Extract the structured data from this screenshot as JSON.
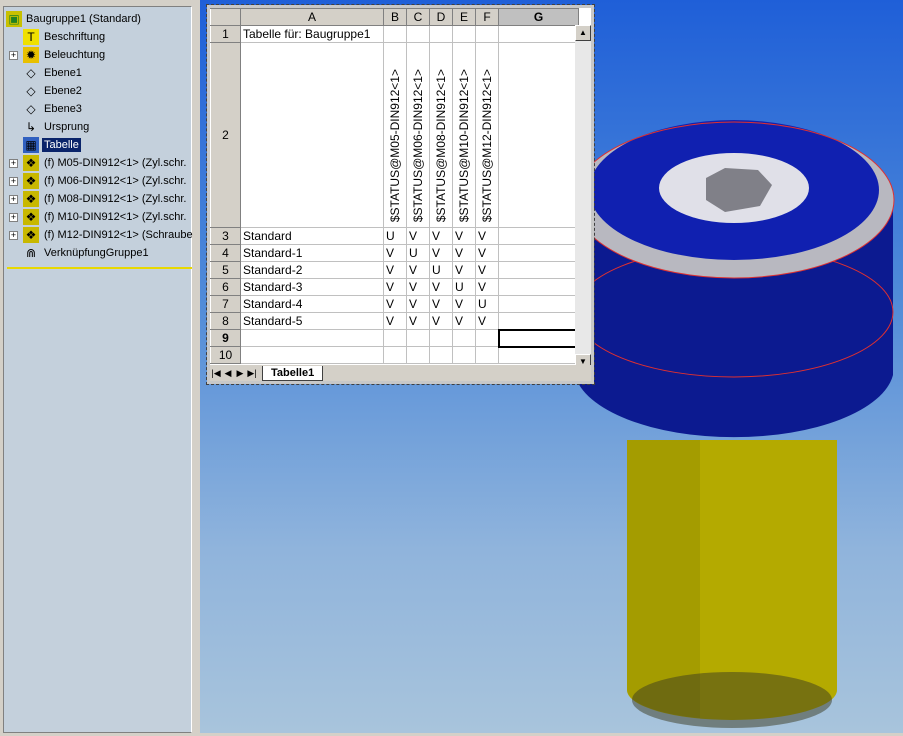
{
  "tree": {
    "root": "Baugruppe1  (Standard)",
    "items": [
      {
        "label": "Beschriftung",
        "icon": "annotation-icon",
        "expand": false
      },
      {
        "label": "Beleuchtung",
        "icon": "lighting-folder-icon",
        "expand": true
      },
      {
        "label": "Ebene1",
        "icon": "plane-icon",
        "expand": false
      },
      {
        "label": "Ebene2",
        "icon": "plane-icon",
        "expand": false
      },
      {
        "label": "Ebene3",
        "icon": "plane-icon",
        "expand": false
      },
      {
        "label": "Ursprung",
        "icon": "origin-icon",
        "expand": false
      },
      {
        "label": "Tabelle",
        "icon": "design-table-icon",
        "expand": false,
        "selected": true
      },
      {
        "label": "(f) M05-DIN912<1> (Zyl.schr.",
        "icon": "part-icon",
        "expand": true
      },
      {
        "label": "(f) M06-DIN912<1> (Zyl.schr.",
        "icon": "part-icon",
        "expand": true
      },
      {
        "label": "(f) M08-DIN912<1> (Zyl.schr.",
        "icon": "part-icon",
        "expand": true
      },
      {
        "label": "(f) M10-DIN912<1> (Zyl.schr.",
        "icon": "part-icon",
        "expand": true
      },
      {
        "label": "(f) M12-DIN912<1> (Schraube",
        "icon": "part-icon",
        "expand": true
      },
      {
        "label": "VerknüpfungGruppe1",
        "icon": "mates-icon",
        "expand": false
      }
    ]
  },
  "sheet": {
    "columns": [
      "A",
      "B",
      "C",
      "D",
      "E",
      "F",
      "G"
    ],
    "row_numbers": [
      "1",
      "2",
      "3",
      "4",
      "5",
      "6",
      "7",
      "8",
      "9",
      "10"
    ],
    "title": "Tabelle für: Baugruppe1",
    "headers": [
      "$STATUS@M05-DIN912<1>",
      "$STATUS@M06-DIN912<1>",
      "$STATUS@M08-DIN912<1>",
      "$STATUS@M10-DIN912<1>",
      "$STATUS@M12-DIN912<1>"
    ],
    "rows": [
      {
        "name": "Standard",
        "values": [
          "U",
          "V",
          "V",
          "V",
          "V"
        ]
      },
      {
        "name": "Standard-1",
        "values": [
          "V",
          "U",
          "V",
          "V",
          "V"
        ]
      },
      {
        "name": "Standard-2",
        "values": [
          "V",
          "V",
          "U",
          "V",
          "V"
        ]
      },
      {
        "name": "Standard-3",
        "values": [
          "V",
          "V",
          "V",
          "U",
          "V"
        ]
      },
      {
        "name": "Standard-4",
        "values": [
          "V",
          "V",
          "V",
          "V",
          "U"
        ]
      },
      {
        "name": "Standard-5",
        "values": [
          "V",
          "V",
          "V",
          "V",
          "V"
        ]
      }
    ],
    "tab": "Tabelle1"
  },
  "colors": {
    "selection": "#0a246a",
    "bolt_head": "#0a1a8c",
    "bolt_shaft": "#a8a000"
  }
}
